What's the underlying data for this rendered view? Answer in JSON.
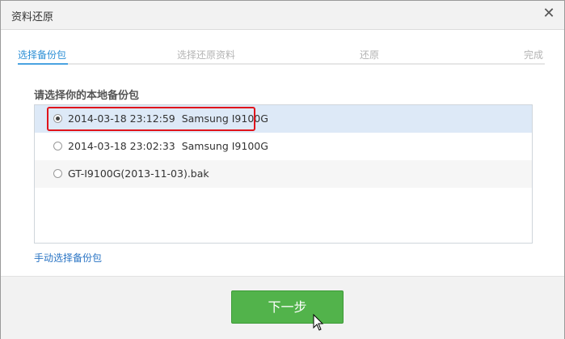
{
  "window": {
    "title": "资料还原",
    "close_glyph": "✕"
  },
  "steps": [
    {
      "label": "选择备份包",
      "active": true
    },
    {
      "label": "选择还原资料",
      "active": false
    },
    {
      "label": "还原",
      "active": false
    },
    {
      "label": "完成",
      "active": false
    }
  ],
  "section_label": "请选择你的本地备份包",
  "backups": [
    {
      "label": "2014-03-18 23:12:59  Samsung I9100G",
      "selected": true
    },
    {
      "label": "2014-03-18 23:02:33  Samsung I9100G",
      "selected": false
    },
    {
      "label": "GT-I9100G(2013-11-03).bak",
      "selected": false
    }
  ],
  "manual_select_label": "手动选择备份包",
  "next_button_label": "下一步",
  "colors": {
    "accent_blue": "#2c8fd6",
    "button_green": "#52b34b",
    "highlight_red": "#e0141c",
    "selected_row": "#dde9f7"
  }
}
